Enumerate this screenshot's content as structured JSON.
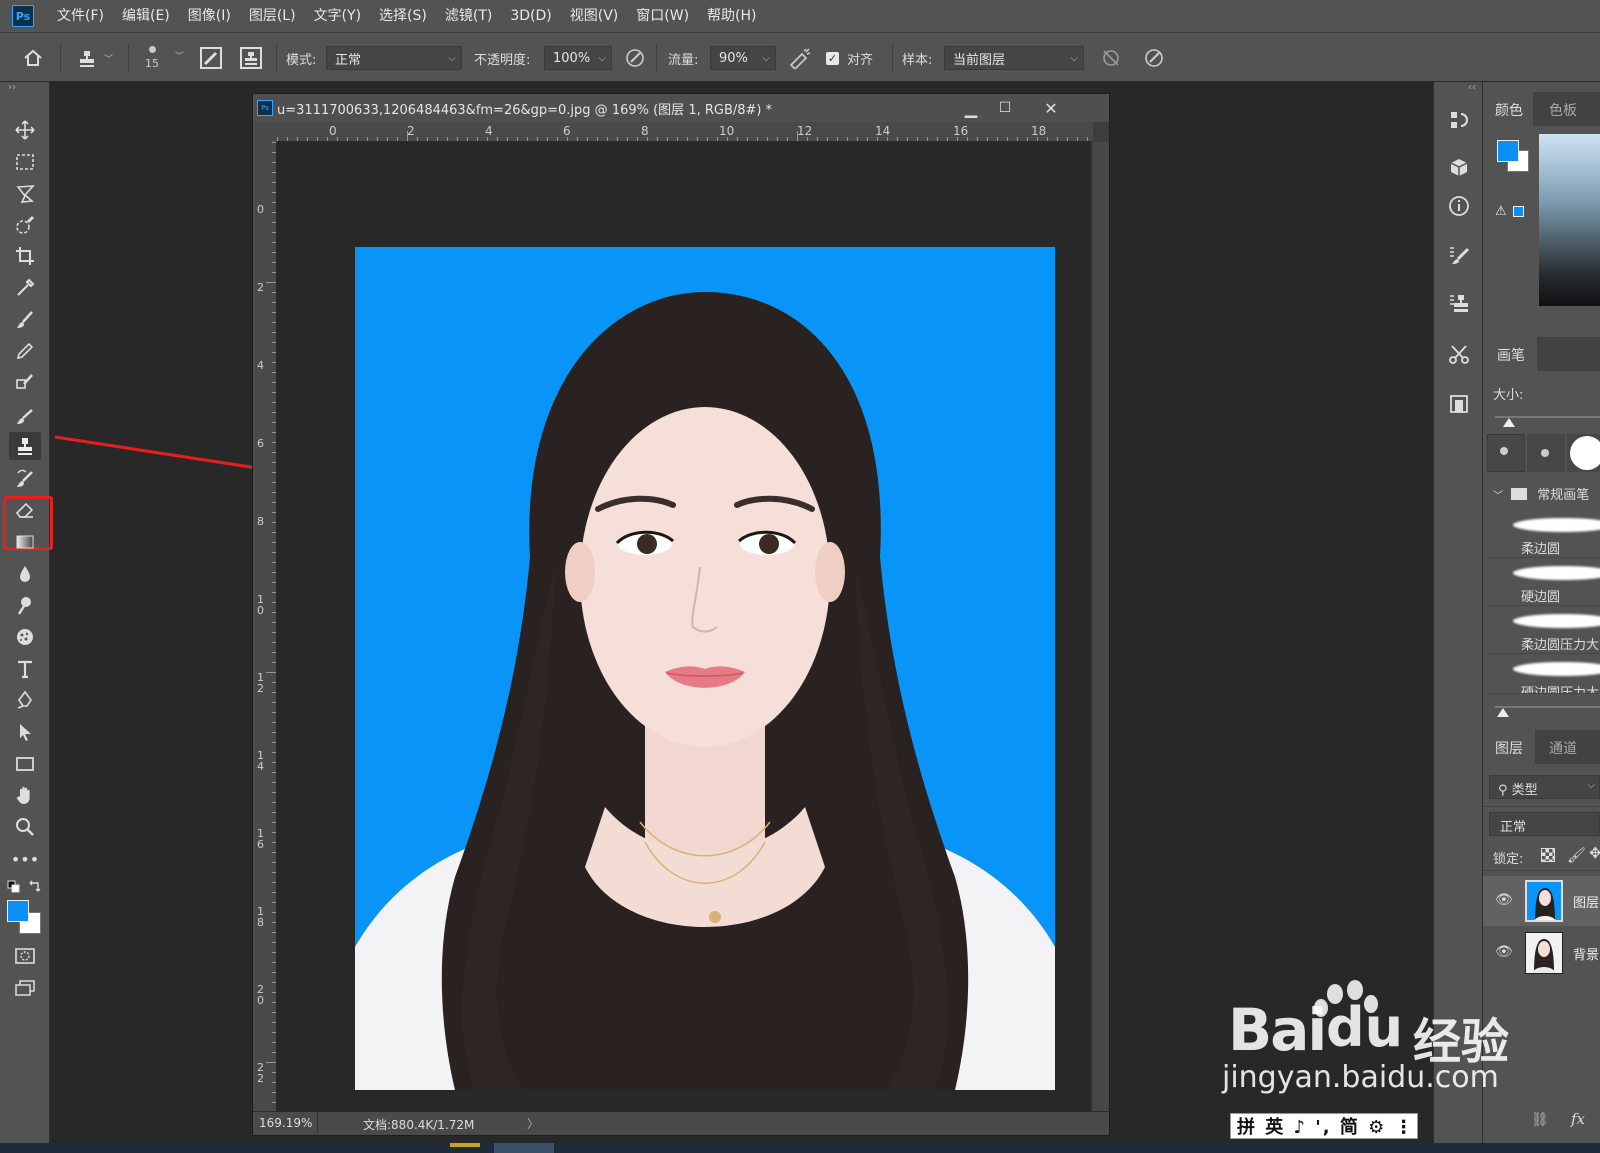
{
  "app": {
    "logo": "Ps"
  },
  "menu": [
    "文件(F)",
    "编辑(E)",
    "图像(I)",
    "图层(L)",
    "文字(Y)",
    "选择(S)",
    "滤镜(T)",
    "3D(D)",
    "视图(V)",
    "窗口(W)",
    "帮助(H)"
  ],
  "options": {
    "brush_size": "15",
    "mode_label": "模式:",
    "mode_value": "正常",
    "opacity_label": "不透明度:",
    "opacity_value": "100%",
    "flow_label": "流量:",
    "flow_value": "90%",
    "align_label": "对齐",
    "align_checked": true,
    "sample_label": "样本:",
    "sample_value": "当前图层"
  },
  "document": {
    "title": "u=3111700633,1206484463&fm=26&gp=0.jpg @ 169% (图层 1, RGB/8#) *",
    "zoom": "169.19%",
    "doc_info": "文档:880.4K/1.72M",
    "background_color": "#0995f7",
    "ruler_top": [
      "0",
      "2",
      "4",
      "6",
      "8",
      "10",
      "12",
      "14",
      "16",
      "18"
    ],
    "ruler_left": [
      "0",
      "2",
      "4",
      "6",
      "8",
      "1\n0",
      "1\n2",
      "1\n4",
      "1\n6",
      "1\n8",
      "2\n0",
      "2\n2"
    ]
  },
  "toolbar": {
    "foreground_color": "#0a8ff5",
    "background_color": "#ffffff",
    "highlight_color": "#e61f1f",
    "tools": [
      "move-icon",
      "marquee-icon",
      "lasso-icon",
      "quick-select-icon",
      "crop-icon",
      "eyedropper-icon",
      "healing-brush-icon",
      "brush-icon",
      "pencil-icon",
      "clone-stamp-icon",
      "history-brush-icon",
      "eraser-icon",
      "gradient-icon",
      "blur-icon",
      "dodge-icon",
      "sponge-icon",
      "type-icon",
      "pen-icon",
      "path-select-icon",
      "rectangle-icon",
      "hand-icon",
      "zoom-icon",
      "more-tools-icon"
    ]
  },
  "panels": {
    "color_tabs": [
      "颜色",
      "色板"
    ],
    "brush_tab": "画笔",
    "size_label": "大小:",
    "brush_group": "常规画笔",
    "brushes": [
      "柔边圆",
      "硬边圆",
      "柔边圆压力大",
      "硬边圆压力大"
    ],
    "layer_tabs": [
      "图层",
      "通道"
    ],
    "layer_filter": "类型",
    "blend_mode": "正常",
    "lock_label": "锁定:",
    "layers": [
      "图层",
      "背景"
    ]
  },
  "watermark": {
    "brand": "Bai",
    "brand2": "经验",
    "url": "jingyan.baidu.com"
  },
  "ime": "拼 英 ♪ ', 简 ⚙ ⋮"
}
